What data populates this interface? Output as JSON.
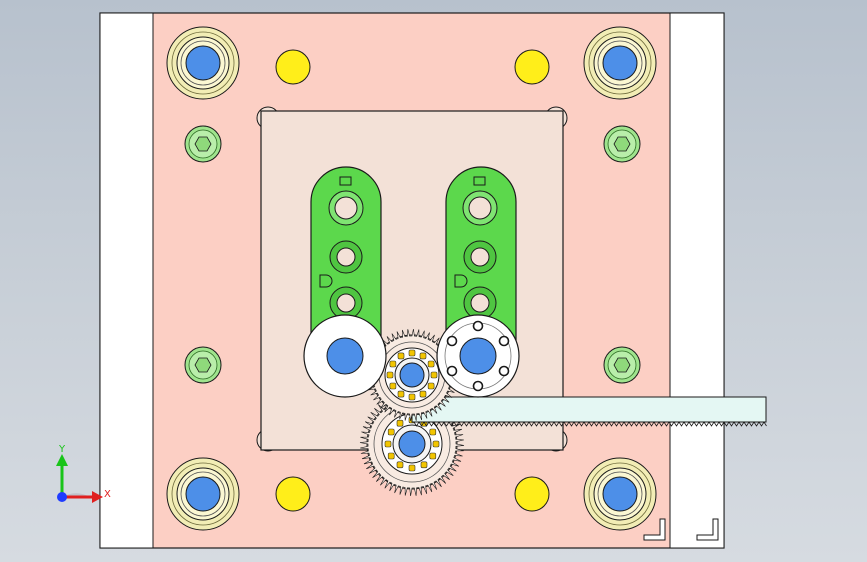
{
  "viewport": {
    "background_top": "#b7c1cd",
    "background_bottom": "#d6dbe1"
  },
  "colors": {
    "base_plate": "#fccfc4",
    "side_rail": "#ffffff",
    "center_plate": "#f3e1d7",
    "slider_arm": "#5cd84c",
    "guide_bushing_ring": "#f2edb5",
    "guide_pin": "#4d8fe8",
    "yellow_pin": "#ffee1a",
    "green_bolt": "#9fe48d",
    "gear": "#f8ebe2",
    "rack": "#e4f7f3",
    "bearing_ball": "#f2c500",
    "outline": "#1a1a1a"
  },
  "components": {
    "guide_bushings": [
      "guide-bushing-top-left",
      "guide-bushing-top-right",
      "guide-bushing-bottom-left",
      "guide-bushing-bottom-right"
    ],
    "yellow_pins": [
      "yellow-pin-top-left",
      "yellow-pin-top-right",
      "yellow-pin-bottom-left",
      "yellow-pin-bottom-right"
    ],
    "socket_bolts": [
      "bolt-upper-left",
      "bolt-upper-right",
      "bolt-lower-left",
      "bolt-lower-right"
    ],
    "slider_arms": [
      "slider-arm-left",
      "slider-arm-right"
    ],
    "gears": [
      "gear-upper",
      "gear-lower"
    ],
    "rack": "gear-rack"
  },
  "axes": {
    "y_label": "Y",
    "x_label": "X",
    "y_color": "#19c419",
    "x_color": "#e02020",
    "origin_color": "#1f3cff"
  }
}
